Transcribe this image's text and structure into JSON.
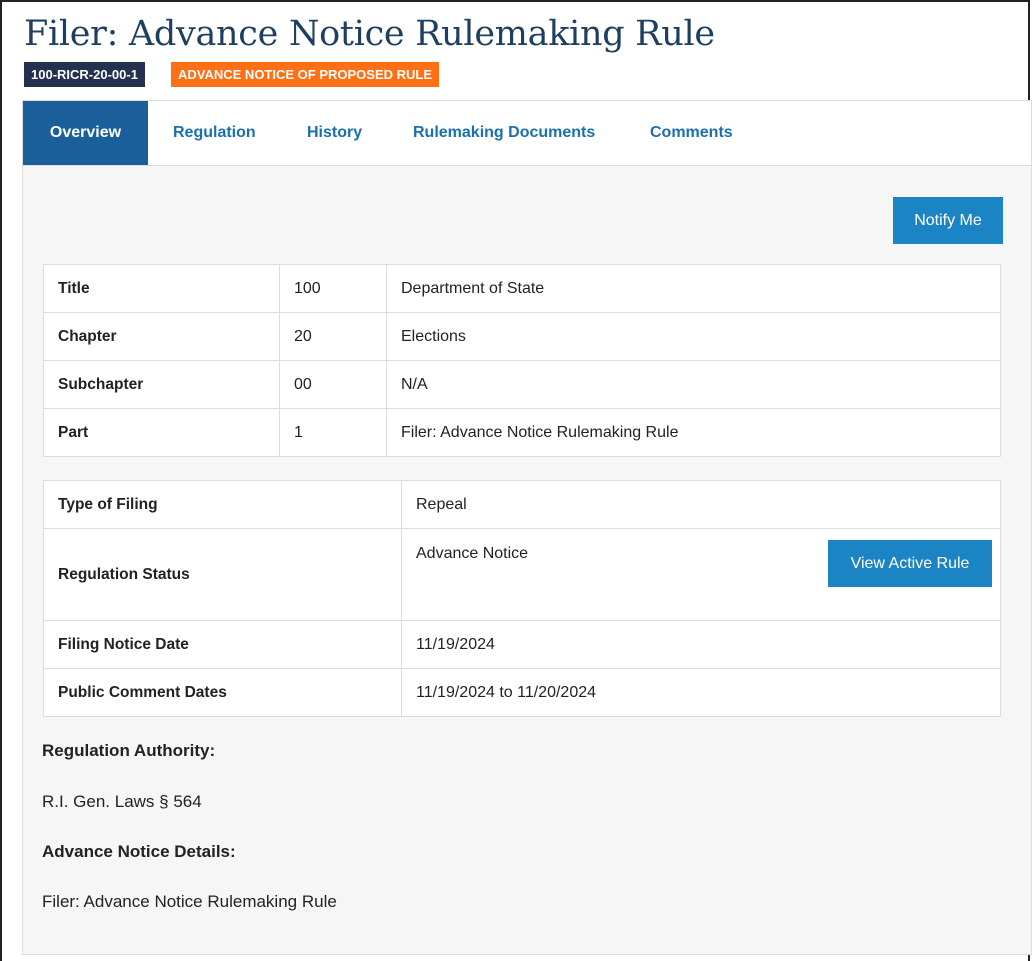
{
  "header": {
    "title": "Filer: Advance Notice Rulemaking Rule",
    "id_badge": "100-RICR-20-00-1",
    "type_badge": "ADVANCE NOTICE OF PROPOSED RULE"
  },
  "tabs": [
    {
      "label": "Overview",
      "active": true
    },
    {
      "label": "Regulation",
      "active": false
    },
    {
      "label": "History",
      "active": false
    },
    {
      "label": "Rulemaking Documents",
      "active": false
    },
    {
      "label": "Comments",
      "active": false
    }
  ],
  "actions": {
    "notify_label": "Notify Me",
    "view_active_label": "View Active Rule"
  },
  "classification": [
    {
      "label": "Title",
      "number": "100",
      "name": "Department of State"
    },
    {
      "label": "Chapter",
      "number": "20",
      "name": "Elections"
    },
    {
      "label": "Subchapter",
      "number": "00",
      "name": "N/A"
    },
    {
      "label": "Part",
      "number": "1",
      "name": "Filer: Advance Notice Rulemaking Rule"
    }
  ],
  "filing": {
    "type_label": "Type of Filing",
    "type_value": "Repeal",
    "status_label": "Regulation Status",
    "status_value": "Advance Notice",
    "notice_date_label": "Filing Notice Date",
    "notice_date_value": "11/19/2024",
    "comment_dates_label": "Public Comment Dates",
    "comment_dates_value": "11/19/2024 to 11/20/2024"
  },
  "authority": {
    "heading": "Regulation Authority:",
    "text": "R.I. Gen. Laws § 564"
  },
  "details": {
    "heading": "Advance Notice Details:",
    "text": "Filer: Advance Notice Rulemaking Rule"
  },
  "colors": {
    "title": "#1e3f5f",
    "id_badge": "#23314f",
    "type_badge": "#ff7016",
    "active_tab": "#1a5f9a",
    "tab_link": "#1a6fae",
    "button": "#1b84c4"
  }
}
